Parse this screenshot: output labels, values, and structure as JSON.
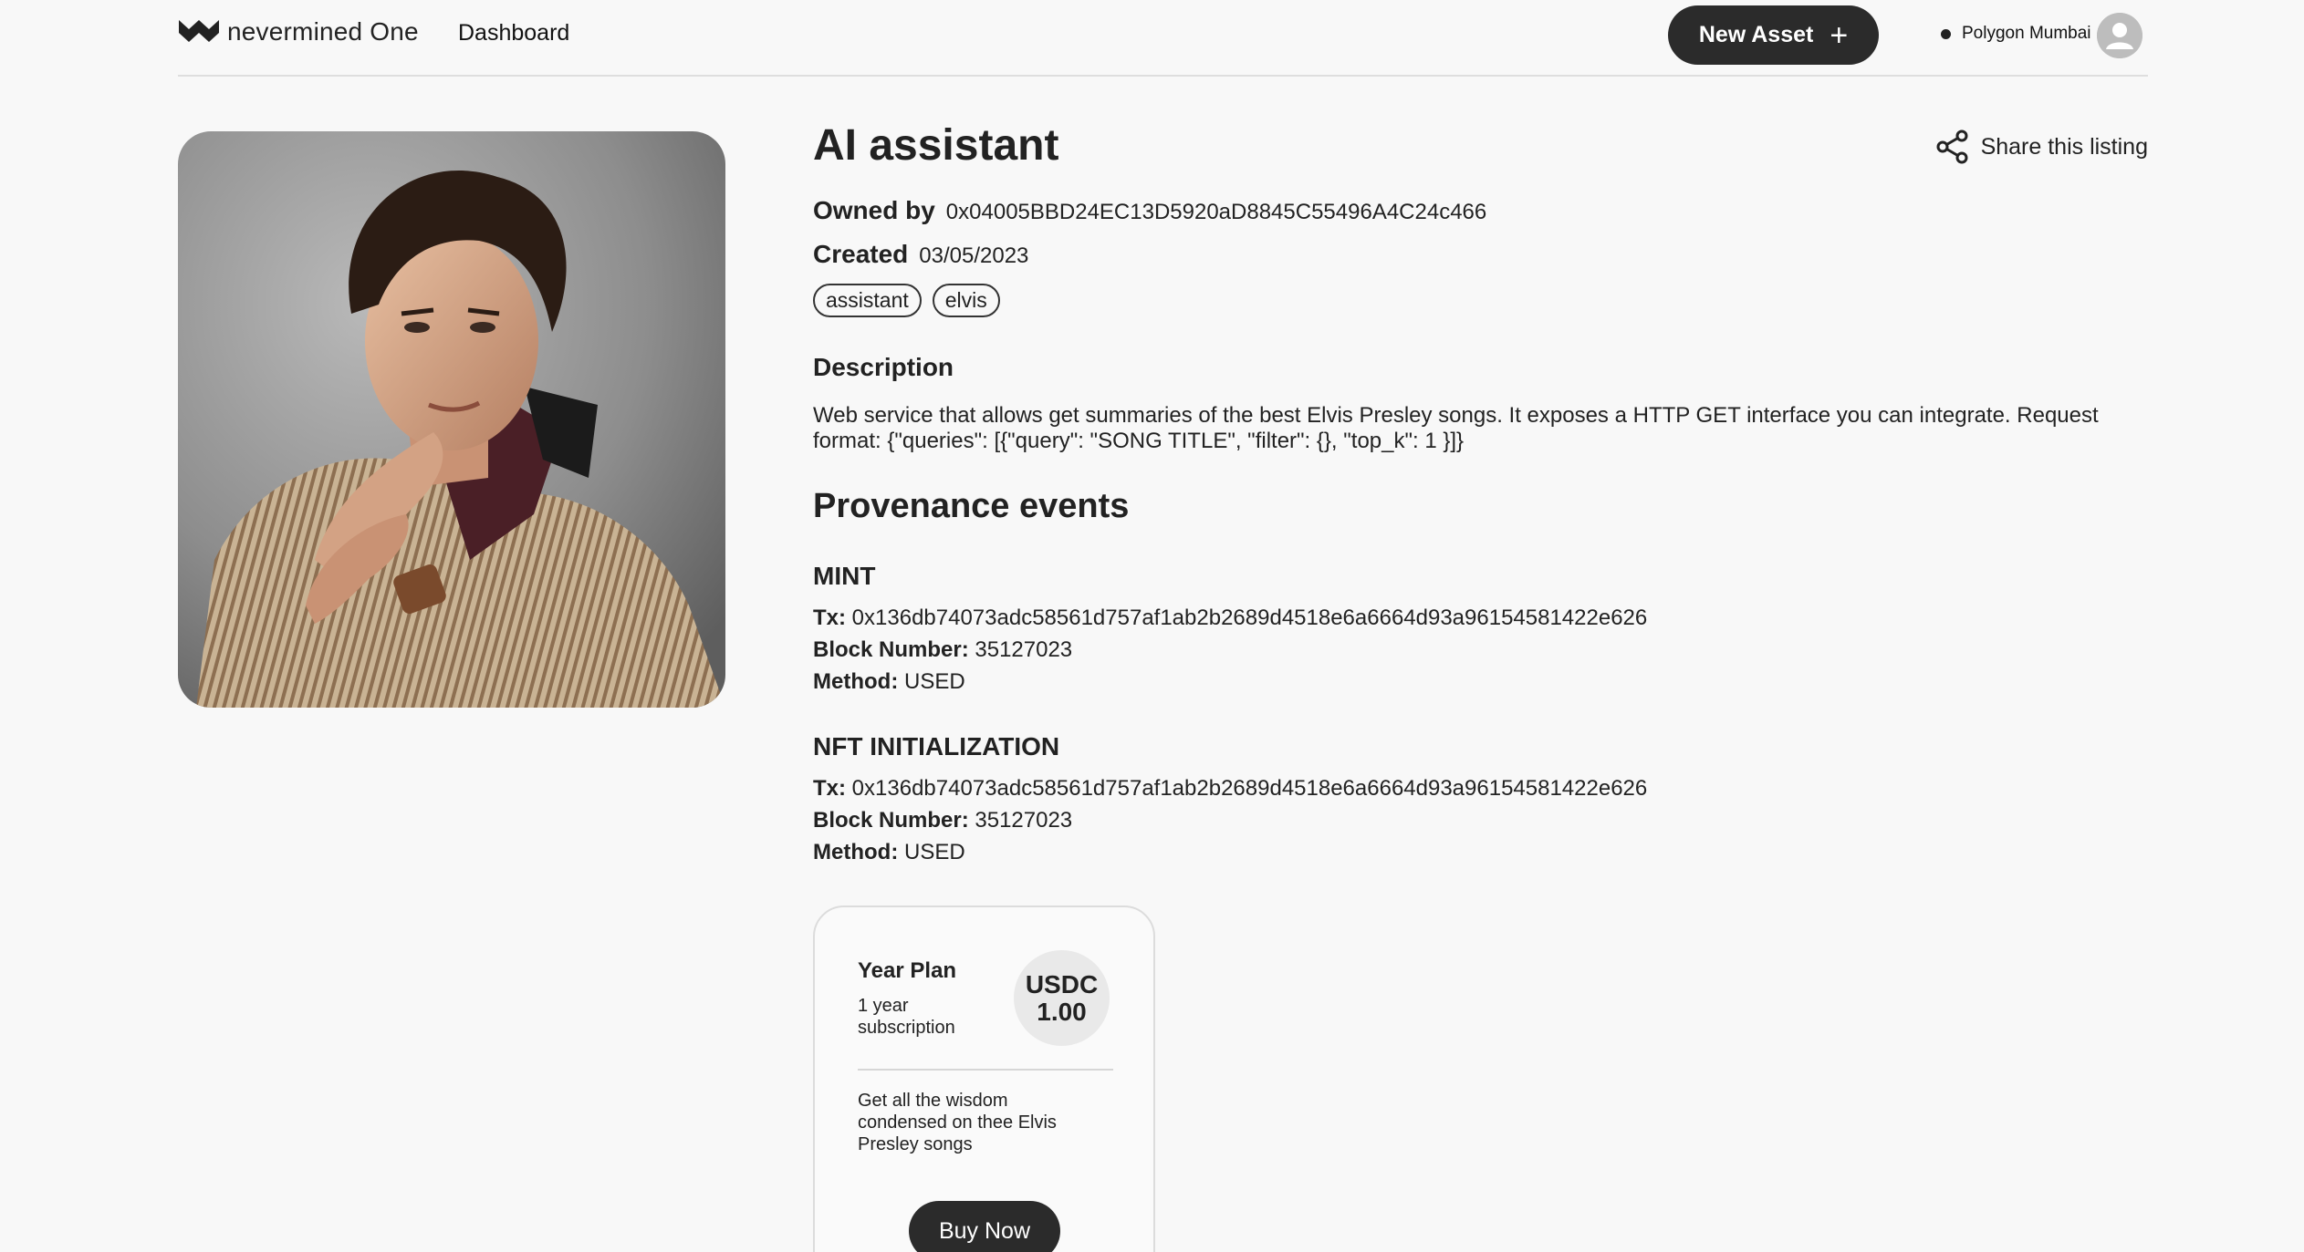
{
  "header": {
    "logo_text": "nevermined",
    "logo_text_bold": "One",
    "nav_dashboard": "Dashboard",
    "new_asset_label": "New Asset",
    "new_asset_icon": "plus-icon",
    "network_label": "Polygon Mumbai",
    "avatar_icon": "user-icon"
  },
  "asset": {
    "title": "AI assistant",
    "share_label": "Share this listing",
    "owned_by_label": "Owned by",
    "owner": "0x04005BBD24EC13D5920aD8845C55496A4C24c466",
    "created_label": "Created",
    "created": "03/05/2023",
    "tags": [
      "assistant",
      "elvis"
    ],
    "description_heading": "Description",
    "description": "Web service that allows get summaries of the best Elvis Presley songs. It exposes a HTTP GET interface you can integrate. Request format: {\"queries\": [{\"query\": \"SONG TITLE\", \"filter\": {}, \"top_k\": 1 }]}",
    "image_subject": "portrait photo"
  },
  "provenance": {
    "heading": "Provenance events",
    "tx_label": "Tx:",
    "block_label": "Block Number:",
    "method_label": "Method:",
    "events": [
      {
        "type": "MINT",
        "tx": "0x136db74073adc58561d757af1ab2b2689d4518e6a6664d93a96154581422e626",
        "block": "35127023",
        "method": "USED"
      },
      {
        "type": "NFT INITIALIZATION",
        "tx": "0x136db74073adc58561d757af1ab2b2689d4518e6a6664d93a96154581422e626",
        "block": "35127023",
        "method": "USED"
      }
    ]
  },
  "plan": {
    "name": "Year Plan",
    "subtitle": "1 year subscription",
    "currency": "USDC",
    "price": "1.00",
    "description": "Get all the wisdom condensed on thee Elvis Presley songs",
    "buy_label": "Buy Now"
  },
  "colors": {
    "background": "#f8f8f8",
    "button_dark": "#2b2b2b",
    "text": "#1f1f1f"
  }
}
